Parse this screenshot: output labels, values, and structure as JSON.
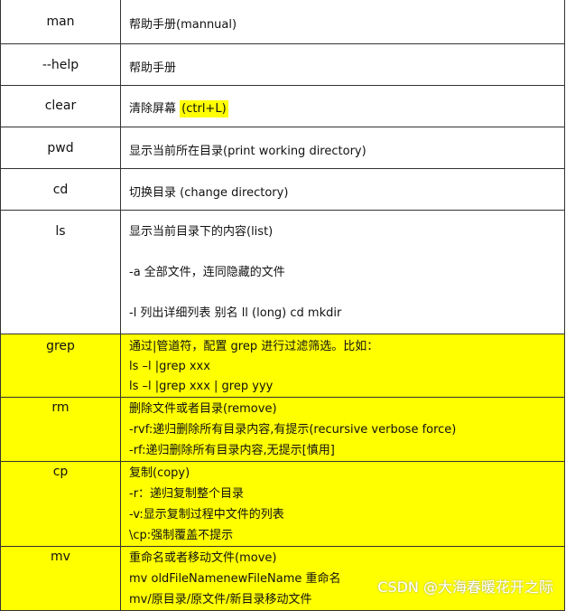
{
  "rows": [
    {
      "cmd": "man",
      "lines": [
        "帮助手册(mannual)"
      ]
    },
    {
      "cmd": "--help",
      "lines": [
        "帮助手册"
      ]
    },
    {
      "cmd": "clear",
      "lines": [
        "清除屏幕",
        "(ctrl+L)"
      ]
    },
    {
      "cmd": "pwd",
      "lines": [
        "显示当前所在目录(print working directory)"
      ]
    },
    {
      "cmd": "cd",
      "lines": [
        "切换目录 (change directory)"
      ]
    },
    {
      "cmd": "ls",
      "lines": [
        "显示当前目录下的内容(list)",
        "-a  全部文件，连同隐藏的文件",
        "-l  列出详细列表  别名 ll    (long)    cd    mkdir"
      ]
    },
    {
      "cmd": "grep",
      "lines": [
        "通过|管道符，配置 grep 进行过滤筛选。比如：",
        "ls  –l |grep xxx",
        "ls  –l |grep xxx | grep yyy"
      ]
    },
    {
      "cmd": "rm",
      "lines": [
        "删除文件或者目录(remove)",
        "-rvf:递归删除所有目录内容,有提示(recursive verbose force)",
        "-rf:递归删除所有目录内容,无提示[慎用]"
      ]
    },
    {
      "cmd": "cp",
      "lines": [
        "复制(copy)",
        "-r：递归复制整个目录",
        "-v:显示复制过程中文件的列表",
        "\\cp:强制覆盖不提示"
      ]
    },
    {
      "cmd": "mv",
      "lines": [
        "重命名或者移动文件(move)",
        "mv    oldFileNamenewFileName 重命名",
        "mv/原目录/原文件/新目录移动文件"
      ]
    }
  ],
  "highlight_color": "#ffff00",
  "watermark": "CSDN @大海春暖花开之际"
}
